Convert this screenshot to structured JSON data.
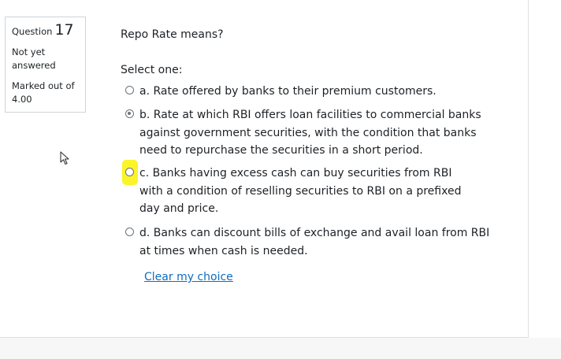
{
  "info": {
    "question_label": "Question",
    "question_number": "17",
    "state": "Not yet answered",
    "grade": "Marked out of 4.00"
  },
  "question": {
    "text": "Repo Rate means?",
    "prompt": "Select one:",
    "options": [
      {
        "letter": "a.",
        "text": "Rate offered by banks to their premium customers.",
        "selected": false
      },
      {
        "letter": "b.",
        "text": "Rate at which RBI offers loan facilities to commercial banks against government securities, with the condition that banks need to repurchase the securities in a short period.",
        "selected": true
      },
      {
        "letter": "c.",
        "text": "Banks having excess cash can buy securities from RBI with a condition of reselling securities to RBI on a prefixed day and price.",
        "selected": false,
        "highlighted": true
      },
      {
        "letter": "d.",
        "text": "Banks can discount bills of exchange and avail loan from RBI at times when cash is needed.",
        "selected": false
      }
    ],
    "clear_label": "Clear my choice"
  },
  "colors": {
    "link": "#0f6cbf",
    "highlight": "#fbf31c",
    "text": "#1d2125",
    "border": "#cfd4d9"
  },
  "icons": {
    "cursor": "mouse-pointer-icon"
  }
}
